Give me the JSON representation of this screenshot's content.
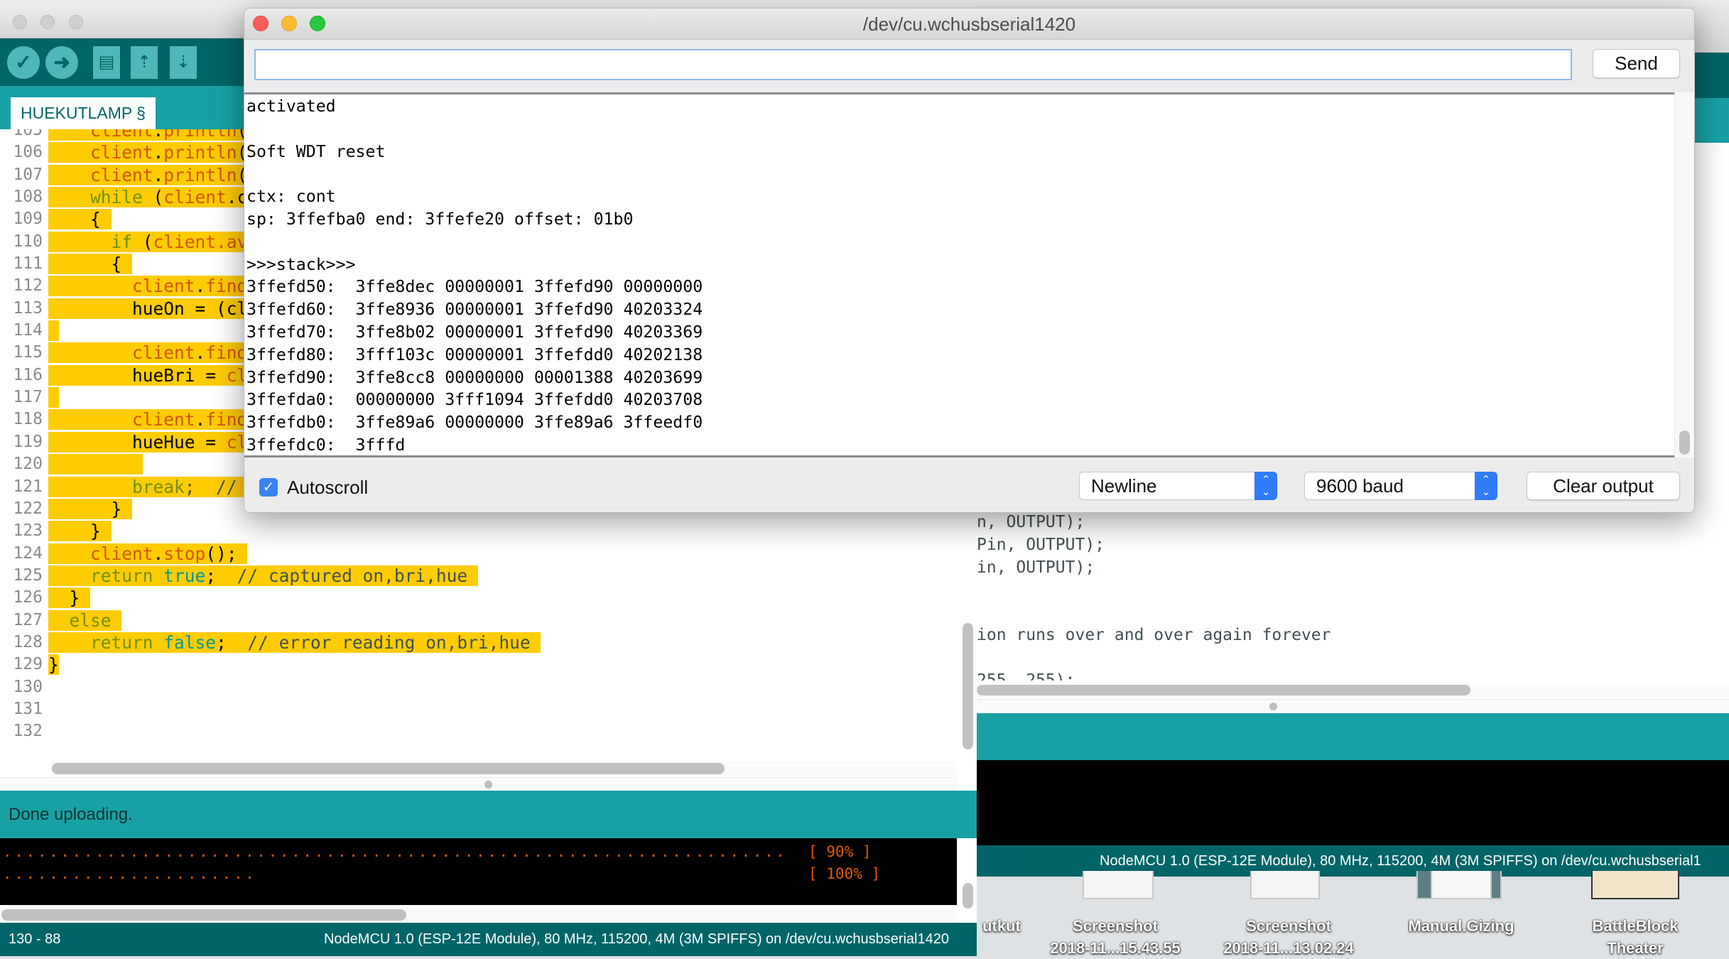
{
  "colors": {
    "teal_dark": "#006468",
    "teal": "#17a1a5",
    "selection": "#ffcc00",
    "fn": "#d35400",
    "kw": "#728e00",
    "lit": "#00979c",
    "comment": "#434f54",
    "console_orange": "#e05a00",
    "accent_blue": "#3b82f6"
  },
  "ide": {
    "toolbar": [
      {
        "icon": "verify-check-icon",
        "glyph": "✓"
      },
      {
        "icon": "upload-arrow-icon",
        "glyph": "➜"
      },
      {
        "icon": "new-file-icon",
        "glyph": "🗎"
      },
      {
        "icon": "open-arrow-up-icon",
        "glyph": "⇡"
      },
      {
        "icon": "save-arrow-down-icon",
        "glyph": "⇣"
      }
    ],
    "tab": "HUEKUTLAMP §",
    "lines": [
      {
        "n": "105",
        "t": [
          [
            "    ",
            "tx"
          ],
          [
            "client",
            "fn"
          ],
          [
            ".",
            "tx"
          ],
          [
            "println",
            "fn"
          ],
          [
            "(",
            "tx"
          ]
        ]
      },
      {
        "n": "106",
        "t": [
          [
            "    ",
            "tx"
          ],
          [
            "client",
            "fn"
          ],
          [
            ".",
            "tx"
          ],
          [
            "println",
            "fn"
          ],
          [
            "('",
            "tx"
          ]
        ]
      },
      {
        "n": "107",
        "t": [
          [
            "    ",
            "tx"
          ],
          [
            "client",
            "fn"
          ],
          [
            ".",
            "tx"
          ],
          [
            "println",
            "fn"
          ],
          [
            "()",
            "tx"
          ]
        ]
      },
      {
        "n": "108",
        "t": [
          [
            "    ",
            "tx"
          ],
          [
            "while",
            "kw"
          ],
          [
            " (",
            "tx"
          ],
          [
            "client",
            "fn"
          ],
          [
            ".co",
            "tx"
          ]
        ]
      },
      {
        "n": "109",
        "t": [
          [
            "    {",
            "tx"
          ]
        ]
      },
      {
        "n": "110",
        "t": [
          [
            "      ",
            "tx"
          ],
          [
            "if",
            "kw"
          ],
          [
            " (",
            "tx"
          ],
          [
            "client",
            "fn"
          ],
          [
            ".ava",
            "fn"
          ]
        ]
      },
      {
        "n": "111",
        "t": [
          [
            "      {",
            "tx"
          ]
        ]
      },
      {
        "n": "112",
        "t": [
          [
            "        ",
            "tx"
          ],
          [
            "client",
            "fn"
          ],
          [
            ".",
            "tx"
          ],
          [
            "findU",
            "fn"
          ]
        ]
      },
      {
        "n": "113",
        "t": [
          [
            "        hueOn = (cl",
            "tx"
          ]
        ]
      },
      {
        "n": "114",
        "t": []
      },
      {
        "n": "115",
        "t": [
          [
            "        ",
            "tx"
          ],
          [
            "client",
            "fn"
          ],
          [
            ".",
            "tx"
          ],
          [
            "findU",
            "fn"
          ]
        ]
      },
      {
        "n": "116",
        "t": [
          [
            "        hueBri = ",
            "tx"
          ],
          [
            "cli",
            "fn"
          ]
        ]
      },
      {
        "n": "117",
        "t": []
      },
      {
        "n": "118",
        "t": [
          [
            "        ",
            "tx"
          ],
          [
            "client",
            "fn"
          ],
          [
            ".",
            "tx"
          ],
          [
            "findU",
            "fn"
          ]
        ]
      },
      {
        "n": "119",
        "t": [
          [
            "        hueHue = ",
            "tx"
          ],
          [
            "cli",
            "fn"
          ]
        ]
      },
      {
        "n": "120",
        "t": [
          [
            "        ",
            "tx"
          ]
        ]
      },
      {
        "n": "121",
        "t": [
          [
            "        ",
            "tx"
          ],
          [
            "break",
            "kw"
          ],
          [
            ";  // r",
            "cm"
          ]
        ]
      },
      {
        "n": "122",
        "t": [
          [
            "      }",
            "tx"
          ]
        ]
      },
      {
        "n": "123",
        "t": [
          [
            "    }",
            "tx"
          ]
        ]
      },
      {
        "n": "124",
        "t": [
          [
            "    ",
            "tx"
          ],
          [
            "client",
            "fn"
          ],
          [
            ".",
            "tx"
          ],
          [
            "stop",
            "fn"
          ],
          [
            "();",
            "tx"
          ]
        ]
      },
      {
        "n": "125",
        "t": [
          [
            "    ",
            "tx"
          ],
          [
            "return",
            "kw"
          ],
          [
            " ",
            "tx"
          ],
          [
            "true",
            "lit"
          ],
          [
            ";  ",
            "tx"
          ],
          [
            "// captured on,bri,hue",
            "cm"
          ]
        ]
      },
      {
        "n": "126",
        "t": [
          [
            "  }",
            "tx"
          ]
        ]
      },
      {
        "n": "127",
        "t": [
          [
            "  ",
            "tx"
          ],
          [
            "else",
            "kw"
          ]
        ]
      },
      {
        "n": "128",
        "t": [
          [
            "    ",
            "tx"
          ],
          [
            "return",
            "kw"
          ],
          [
            " ",
            "tx"
          ],
          [
            "false",
            "lit"
          ],
          [
            ";  ",
            "tx"
          ],
          [
            "// error reading on,bri,hue",
            "cm"
          ]
        ]
      },
      {
        "n": "129",
        "t": [
          [
            "}",
            "tx"
          ]
        ]
      },
      {
        "n": "130",
        "t": []
      },
      {
        "n": "131",
        "t": []
      },
      {
        "n": "132",
        "t": []
      }
    ],
    "status_message": "Done uploading.",
    "console": [
      {
        "dots": "....................................................................",
        "pct": "[ 90% ]"
      },
      {
        "dots": "......................",
        "pct": "[ 100% ]"
      }
    ],
    "cursor_position": "130 - 88",
    "board": "NodeMCU 1.0 (ESP-12E Module), 80 MHz, 115200, 4M (3M SPIFFS) on /dev/cu.wchusbserial1420"
  },
  "serial": {
    "title": "/dev/cu.wchusbserial1420",
    "input_value": "",
    "send_label": "Send",
    "output": [
      "activated",
      "",
      "Soft WDT reset",
      "",
      "ctx: cont",
      "sp: 3ffefba0 end: 3ffefe20 offset: 01b0",
      "",
      ">>>stack>>>",
      "3ffefd50:  3ffe8dec 00000001 3ffefd90 00000000",
      "3ffefd60:  3ffe8936 00000001 3ffefd90 40203324",
      "3ffefd70:  3ffe8b02 00000001 3ffefd90 40203369",
      "3ffefd80:  3fff103c 00000001 3ffefdd0 40202138",
      "3ffefd90:  3ffe8cc8 00000000 00001388 40203699",
      "3ffefda0:  00000000 3fff1094 3ffefdd0 40203708",
      "3ffefdb0:  3ffe89a6 00000000 3ffe89a6 3ffeedf0",
      "3ffefdc0:  3fffd"
    ],
    "autoscroll_label": "Autoscroll",
    "autoscroll_checked": true,
    "line_ending": "Newline",
    "baud": "9600 baud",
    "clear_label": "Clear output"
  },
  "background_window": {
    "code": [
      {
        "text": "n, OUTPUT);"
      },
      {
        "text": "Pin, OUTPUT);"
      },
      {
        "text": "in, OUTPUT);"
      },
      {
        "text": ""
      },
      {
        "text": ""
      },
      {
        "text": "ion runs over and over again forever"
      },
      {
        "text": ""
      },
      {
        "text": "255, 255);"
      }
    ],
    "board": "NodeMCU 1.0 (ESP-12E Module), 80 MHz, 115200, 4M (3M SPIFFS) on /dev/cu.wchusbserial1"
  },
  "desktop": {
    "icons": [
      {
        "label": "utkut",
        "sublabel": ""
      },
      {
        "label": "Screenshot",
        "sublabel": "2018-11...15.43.55"
      },
      {
        "label": "Screenshot",
        "sublabel": "2018-11...13.02.24"
      },
      {
        "label": "Manual.Gizing",
        "sublabel": ""
      },
      {
        "label": "BattleBlock",
        "sublabel": "Theater"
      }
    ]
  }
}
